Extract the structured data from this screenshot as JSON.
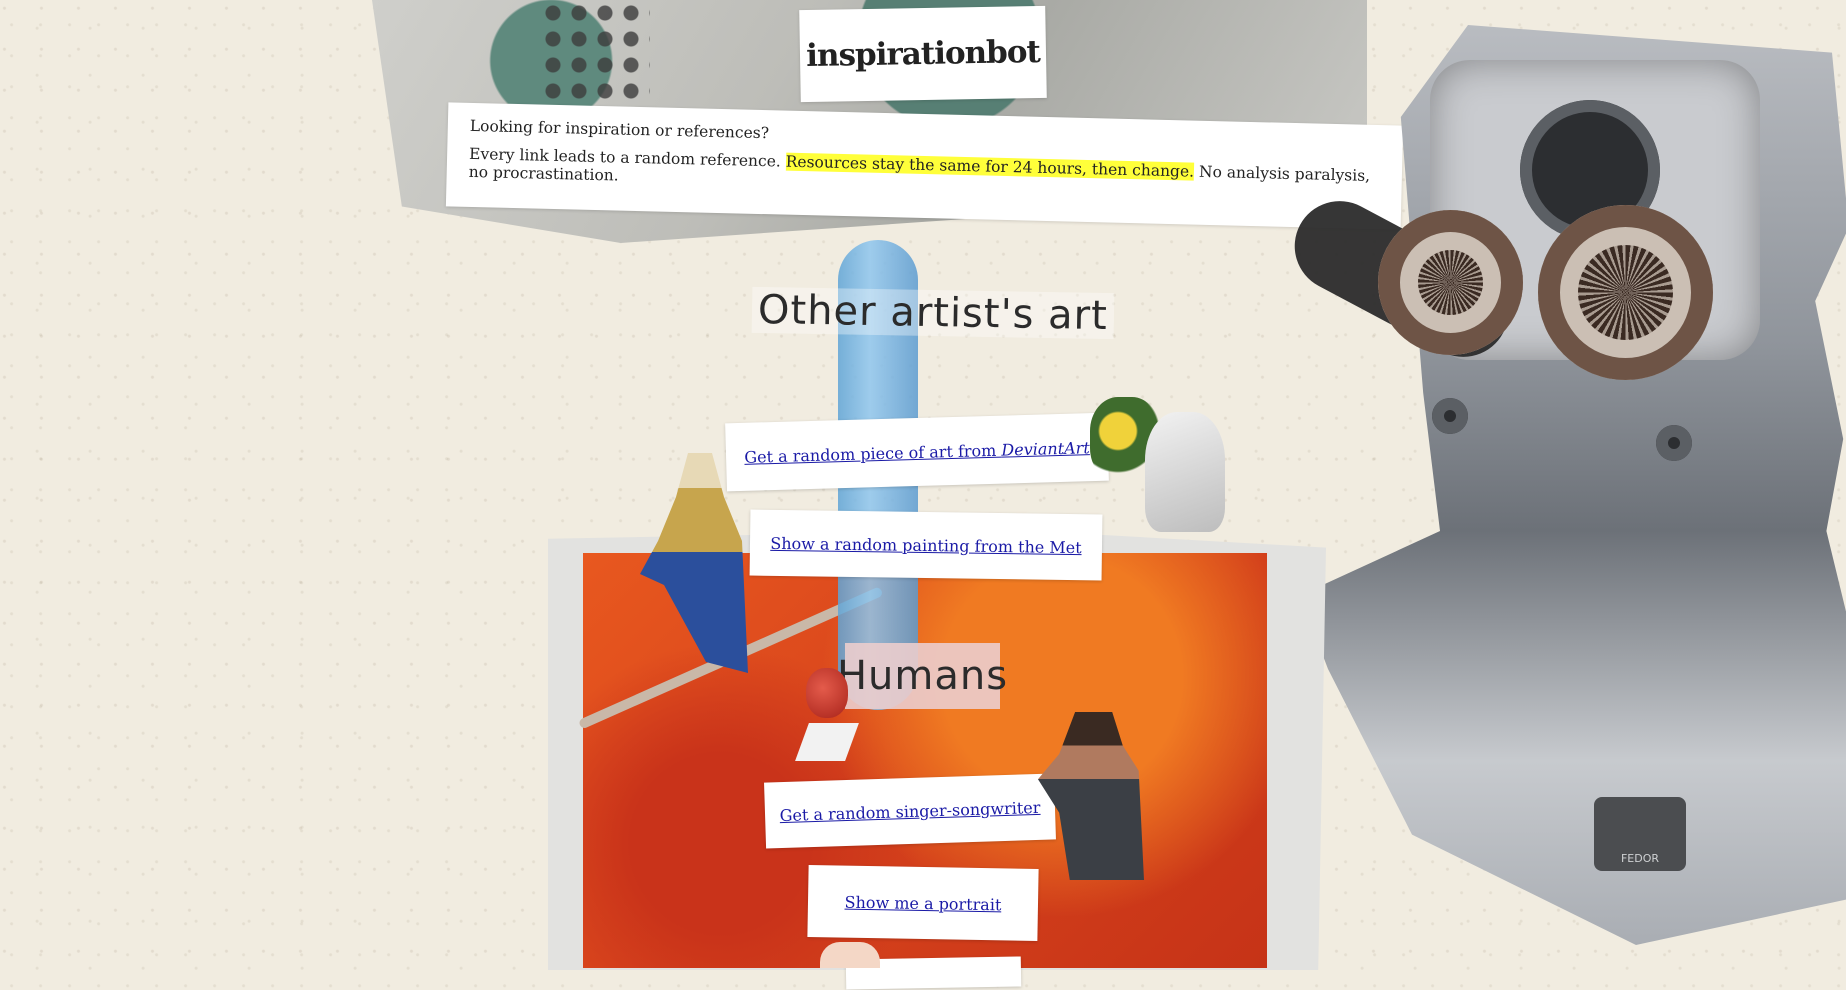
{
  "site": {
    "title": "inspirationbot"
  },
  "intro": {
    "line1": "Looking for inspiration or references?",
    "line2_prefix": "Every link leads to a random reference.",
    "line2_highlight": "Resources stay the same for 24 hours, then change.",
    "line2_suffix": "No analysis paralysis, no procrastination."
  },
  "sections": [
    {
      "heading": "Other artist's art",
      "links": [
        {
          "label": "Get a random piece of art from",
          "label_em": "DeviantArt"
        },
        {
          "label": "Show a random painting from the Met"
        }
      ]
    },
    {
      "heading": "Humans",
      "links": [
        {
          "label": "Get a random singer-songwriter"
        },
        {
          "label": "Show me a portrait"
        }
      ]
    }
  ],
  "decor": {
    "robot_plate": "FEDOR",
    "highlight_color": "#ffff3a",
    "link_color": "#1a1aa6"
  }
}
